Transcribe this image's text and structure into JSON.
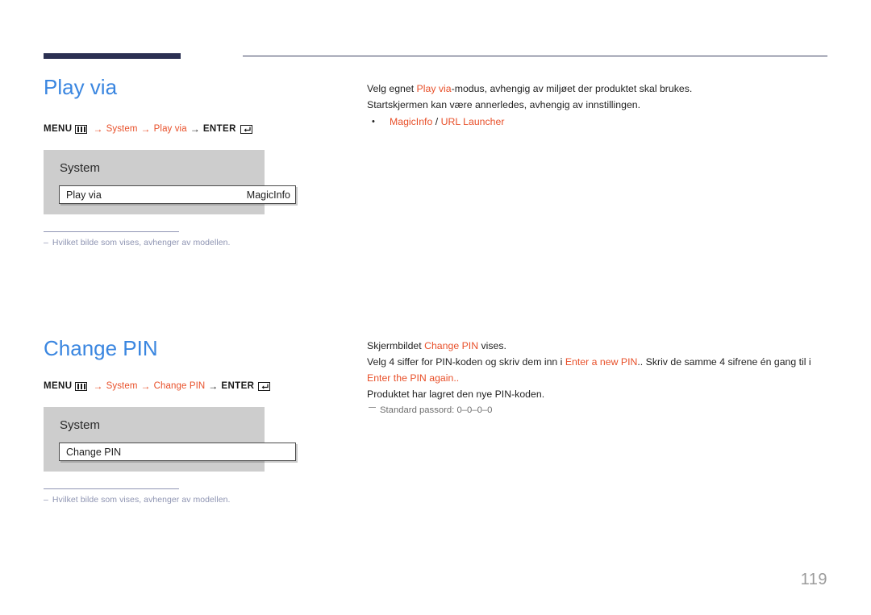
{
  "page": {
    "number": "119"
  },
  "sections": [
    {
      "id": "play-via",
      "title": "Play via",
      "menu_path": {
        "menu_label": "MENU",
        "menu_icon": "menu-grid-icon",
        "arrow": "→",
        "steps": [
          "System",
          "Play via"
        ],
        "enter_label": "ENTER",
        "enter_icon": "enter-return-icon"
      },
      "osd": {
        "title": "System",
        "row_label": "Play via",
        "row_value": "MagicInfo"
      },
      "footnote": "Hvilket bilde som vises, avhenger av modellen.",
      "footnote_dash": "–",
      "body": {
        "line1_pre": "Velg egnet ",
        "line1_accent": "Play via",
        "line1_post": "-modus, avhengig av miljøet der produktet skal brukes.",
        "line2": "Startskjermen kan være annerledes, avhengig av innstillingen.",
        "bullet_dot": "•",
        "bullet_a": "MagicInfo",
        "bullet_slash": " / ",
        "bullet_b": "URL Launcher"
      }
    },
    {
      "id": "change-pin",
      "title": "Change PIN",
      "menu_path": {
        "menu_label": "MENU",
        "menu_icon": "menu-grid-icon",
        "arrow": "→",
        "steps": [
          "System",
          "Change PIN"
        ],
        "enter_label": "ENTER",
        "enter_icon": "enter-return-icon"
      },
      "osd": {
        "title": "System",
        "row_label": "Change PIN",
        "row_value": ""
      },
      "footnote": "Hvilket bilde som vises, avhenger av modellen.",
      "footnote_dash": "–",
      "body": {
        "l1_pre": "Skjermbildet ",
        "l1_accent": "Change PIN",
        "l1_post": " vises.",
        "l2_pre": "Velg 4 siffer for PIN-koden og skriv dem inn i ",
        "l2_accent1": "Enter a new PIN",
        "l2_mid": ".. Skriv de samme 4 sifrene én gang til i ",
        "l2_accent2": "Enter the PIN again",
        "l2_post": "..",
        "l3": "Produktet har lagret den nye PIN-koden.",
        "note": "Standard passord: 0–0–0–0"
      }
    }
  ],
  "colors": {
    "heading_blue": "#3a86e0",
    "accent_orange": "#e8502a",
    "rule_navy": "#2b3052",
    "osd_gray": "#cdcdcd",
    "footnote_blue_gray": "#8e94b2",
    "page_number_gray": "#9b9b9b"
  }
}
